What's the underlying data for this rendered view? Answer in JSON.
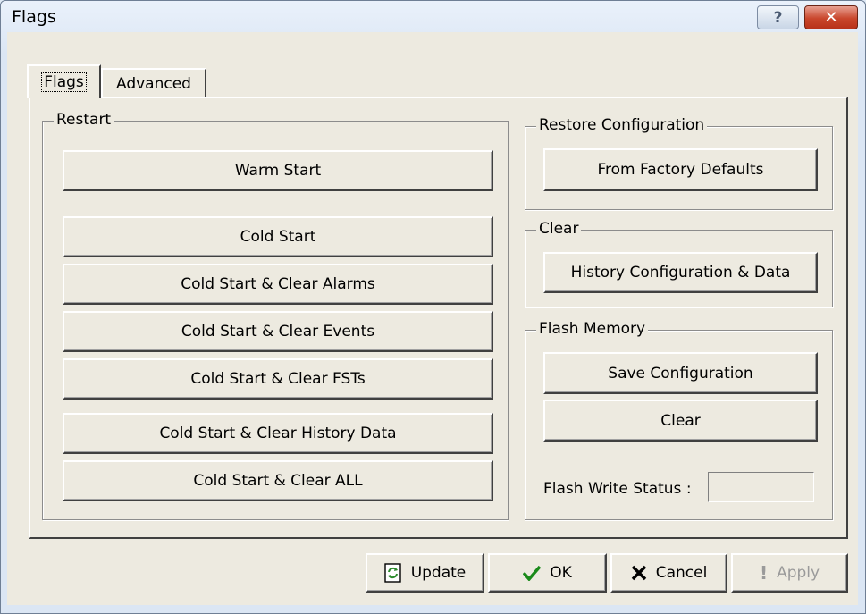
{
  "window": {
    "title": "Flags",
    "help_glyph": "?",
    "close_glyph": "✕"
  },
  "tabs": [
    {
      "label": "Flags",
      "active": true
    },
    {
      "label": "Advanced",
      "active": false
    }
  ],
  "restart": {
    "label": "Restart",
    "buttons": [
      "Warm Start",
      "Cold Start",
      "Cold Start & Clear Alarms",
      "Cold Start & Clear Events",
      "Cold Start & Clear FSTs",
      "Cold Start & Clear History Data",
      "Cold Start & Clear ALL"
    ]
  },
  "restore": {
    "label": "Restore Configuration",
    "button": "From Factory Defaults"
  },
  "clear": {
    "label": "Clear",
    "button": "History Configuration & Data"
  },
  "flash": {
    "label": "Flash Memory",
    "save_button": "Save Configuration",
    "clear_button": "Clear",
    "status_label": "Flash Write Status :",
    "status_value": ""
  },
  "footer": {
    "update": "Update",
    "ok": "OK",
    "cancel": "Cancel",
    "apply": "Apply",
    "icons": {
      "update": "refresh-doc-icon",
      "ok": "checkmark-icon",
      "cancel": "x-icon",
      "apply": "exclamation-icon"
    },
    "colors": {
      "ok_check": "#1a8a1a",
      "cancel_x": "#000000",
      "update_icon": "#2b8a2b"
    }
  }
}
